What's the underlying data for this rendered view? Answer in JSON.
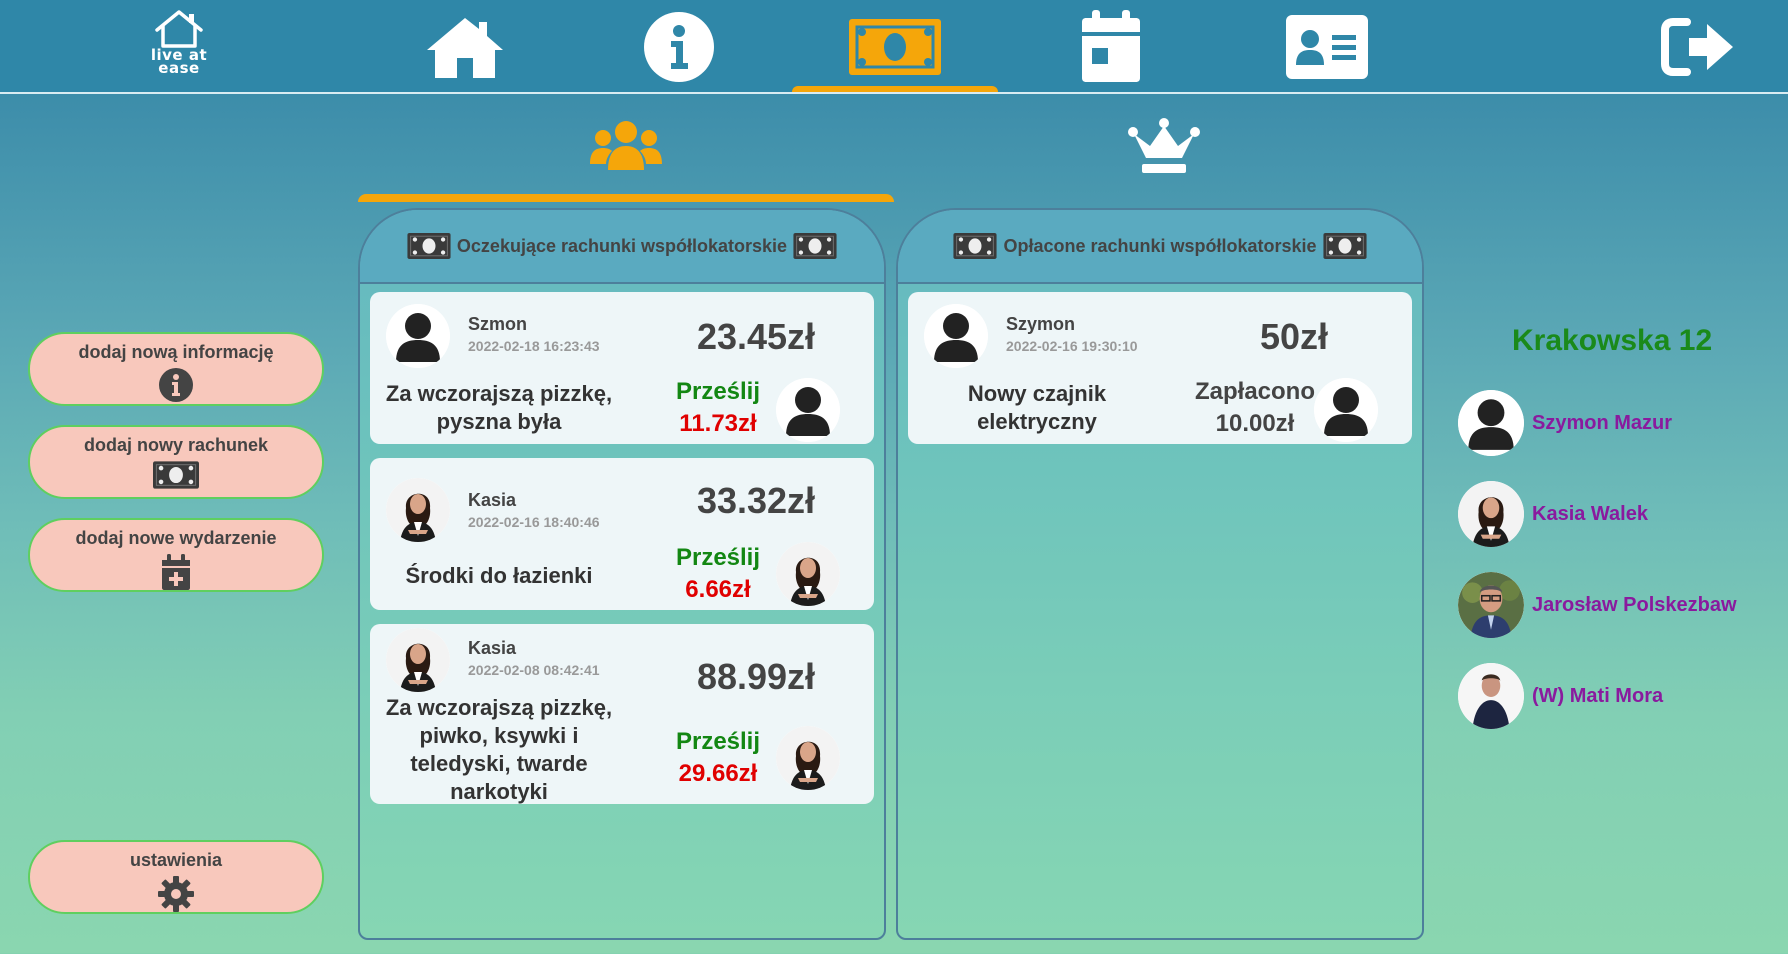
{
  "app": {
    "logo_text": [
      "live at",
      "ease"
    ]
  },
  "nav": {
    "items": [
      {
        "icon": "home-icon"
      },
      {
        "icon": "info-icon"
      },
      {
        "icon": "money-icon",
        "active": true
      },
      {
        "icon": "calendar-icon"
      },
      {
        "icon": "contact-card-icon"
      },
      {
        "icon": "logout-icon"
      }
    ],
    "accent": "#f5a60a"
  },
  "subtabs": [
    {
      "icon": "group-icon",
      "active": true
    },
    {
      "icon": "crown-icon",
      "active": false
    }
  ],
  "sidebar": {
    "add_info": "dodaj nową informację",
    "add_bill": "dodaj nowy rachunek",
    "add_event": "dodaj nowe wydarzenie",
    "settings": "ustawienia"
  },
  "pending": {
    "title": "Oczekujące rachunki współlokatorskie",
    "bills": [
      {
        "author": "Szmon",
        "date": "2022-02-18 16:23:43",
        "amount": "23.45zł",
        "description": "Za wczorajszą pizzkę, pyszna była",
        "action": "Prześlij",
        "share": "11.73zł",
        "author_avatar": "default",
        "payee_avatar": "default"
      },
      {
        "author": "Kasia",
        "date": "2022-02-16 18:40:46",
        "amount": "33.32zł",
        "description": "Środki do łazienki",
        "action": "Prześlij",
        "share": "6.66zł",
        "author_avatar": "woman",
        "payee_avatar": "woman"
      },
      {
        "author": "Kasia",
        "date": "2022-02-08 08:42:41",
        "amount": "88.99zł",
        "description": "Za wczorajszą pizzkę, piwko, ksywki i teledyski, twarde narkotyki",
        "action": "Prześlij",
        "share": "29.66zł",
        "author_avatar": "woman",
        "payee_avatar": "woman"
      }
    ]
  },
  "paid": {
    "title": "Opłacone rachunki współlokatorskie",
    "bills": [
      {
        "author": "Szymon",
        "date": "2022-02-16 19:30:10",
        "amount": "50zł",
        "description": "Nowy czajnik elektryczny",
        "action": "Zapłacono",
        "share": "10.00zł",
        "author_avatar": "default",
        "payee_avatar": "default"
      }
    ]
  },
  "flat": {
    "name": "Krakowska 12",
    "members": [
      {
        "name": "Szymon Mazur",
        "avatar": "default"
      },
      {
        "name": "Kasia Walek",
        "avatar": "woman"
      },
      {
        "name": "Jarosław Polskezbaw",
        "avatar": "man-glasses"
      },
      {
        "name": "(W) Mati Mora",
        "avatar": "man"
      }
    ]
  },
  "colors": {
    "nav_bg": "#2f87a8",
    "accent": "#f5a60a",
    "button_bg": "#f8c8bc",
    "button_border": "#5fcf5f",
    "send": "#138713",
    "share": "#e00000",
    "flat_name": "#1a8a1a",
    "member": "#8a1a9e"
  }
}
